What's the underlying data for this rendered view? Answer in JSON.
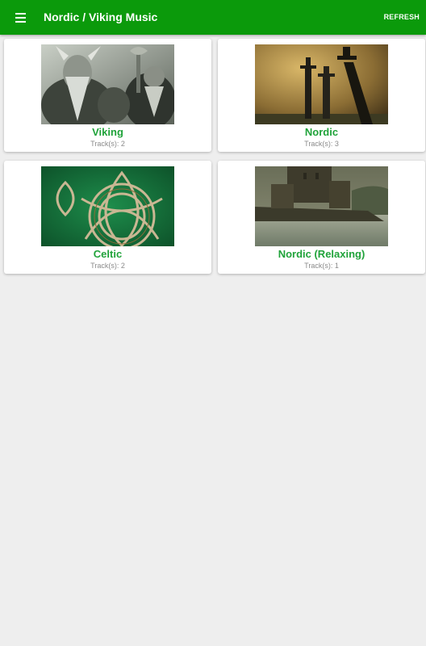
{
  "appbar": {
    "title": "Nordic / Viking Music",
    "refresh_label": "REFRESH",
    "menu_icon": "hamburger-menu-icon",
    "color": "#0b9a0b"
  },
  "grid": {
    "accent_color": "#20a33a",
    "cards": [
      {
        "title": "Viking",
        "tracks_label": "Track(s): 2",
        "image": "viking-warriors-image"
      },
      {
        "title": "Nordic",
        "tracks_label": "Track(s): 3",
        "image": "sword-monument-image"
      },
      {
        "title": "Celtic",
        "tracks_label": "Track(s): 2",
        "image": "celtic-knot-image"
      },
      {
        "title": "Nordic (Relaxing)",
        "tracks_label": "Track(s): 1",
        "image": "castle-lake-image"
      }
    ]
  }
}
